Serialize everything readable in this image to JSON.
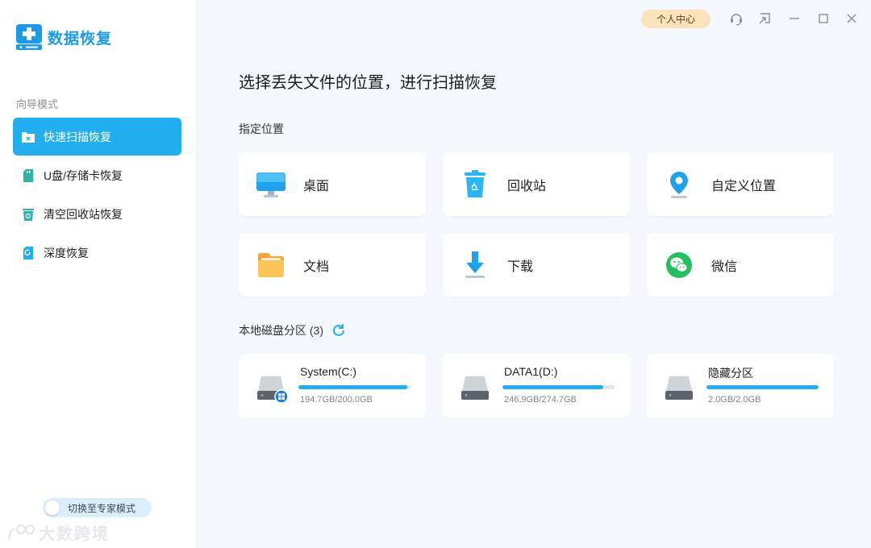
{
  "app": {
    "title": "数据恢复"
  },
  "sidebar": {
    "section_label": "向导模式",
    "items": [
      {
        "label": "快速扫描恢复",
        "icon": "folder-x-icon",
        "active": true
      },
      {
        "label": "U盘/存储卡恢复",
        "icon": "sd-card-icon",
        "active": false
      },
      {
        "label": "清空回收站恢复",
        "icon": "recycle-bin-icon",
        "active": false
      },
      {
        "label": "深度恢复",
        "icon": "deep-scan-icon",
        "active": false
      }
    ],
    "expert_toggle_label": "切换至专家模式",
    "watermark_text": "大数跨境"
  },
  "titlebar": {
    "profile_label": "个人中心"
  },
  "main": {
    "title": "选择丢失文件的位置，进行扫描恢复",
    "locations_label": "指定位置",
    "locations": [
      {
        "label": "桌面",
        "icon": "monitor-icon"
      },
      {
        "label": "回收站",
        "icon": "recycle-bin-icon"
      },
      {
        "label": "自定义位置",
        "icon": "location-pin-icon"
      },
      {
        "label": "文档",
        "icon": "folder-icon"
      },
      {
        "label": "下载",
        "icon": "download-icon"
      },
      {
        "label": "微信",
        "icon": "wechat-icon"
      }
    ],
    "disks_label": "本地磁盘分区 (3)",
    "disks": [
      {
        "name": "System(C:)",
        "size": "194.7GB/200.0GB",
        "used_fraction": 0.974,
        "icon": "system-drive-icon"
      },
      {
        "name": "DATA1(D:)",
        "size": "246.9GB/274.7GB",
        "used_fraction": 0.899,
        "icon": "drive-icon"
      },
      {
        "name": "隐藏分区",
        "size": "2.0GB/2.0GB",
        "used_fraction": 1.0,
        "icon": "drive-icon"
      }
    ]
  },
  "colors": {
    "accent": "#23aef0",
    "profile_bg": "#fde3bc",
    "background": "#f4f8fc"
  }
}
